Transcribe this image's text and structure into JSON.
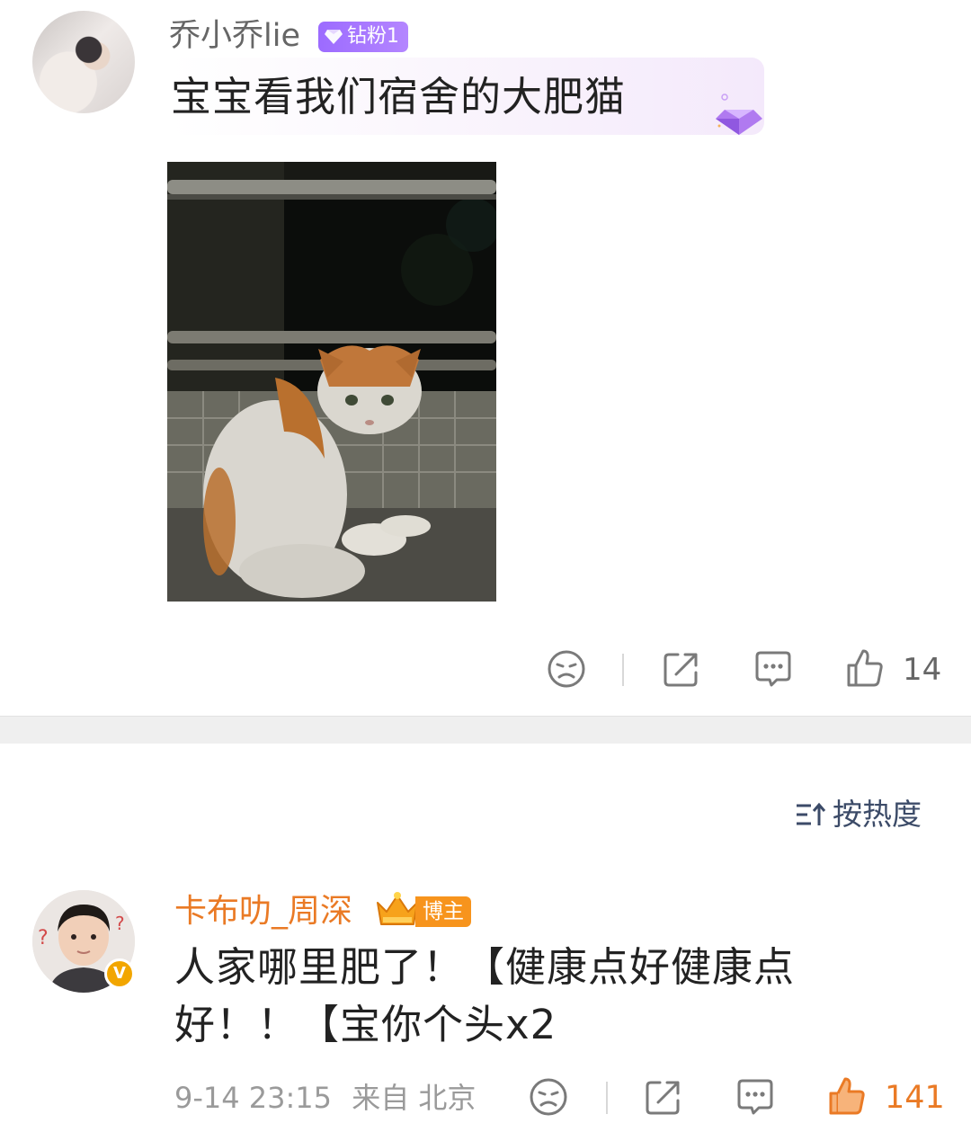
{
  "comment1": {
    "username": "乔小乔lie",
    "fan_badge": "钻粉1",
    "text": "宝宝看我们宿舍的大肥猫",
    "like_count": "14",
    "icons": [
      "dislike-icon",
      "share-icon",
      "reply-icon",
      "like-icon"
    ]
  },
  "sort": {
    "label": "按热度"
  },
  "comment2": {
    "username": "卡布叻_周深",
    "role_badge": "博主",
    "text": "人家哪里肥了！【健康点好健康点好！！【宝你个头x2",
    "timestamp": "9-14 23:15",
    "source": "来自 北京",
    "like_count": "141",
    "icons": [
      "dislike-icon",
      "share-icon",
      "reply-icon",
      "like-icon"
    ]
  },
  "colors": {
    "accent_orange": "#ea7a25",
    "diamond_purple": "#9c6bff",
    "sort_blue": "#3c4b68",
    "divider_gray": "#efefef"
  }
}
